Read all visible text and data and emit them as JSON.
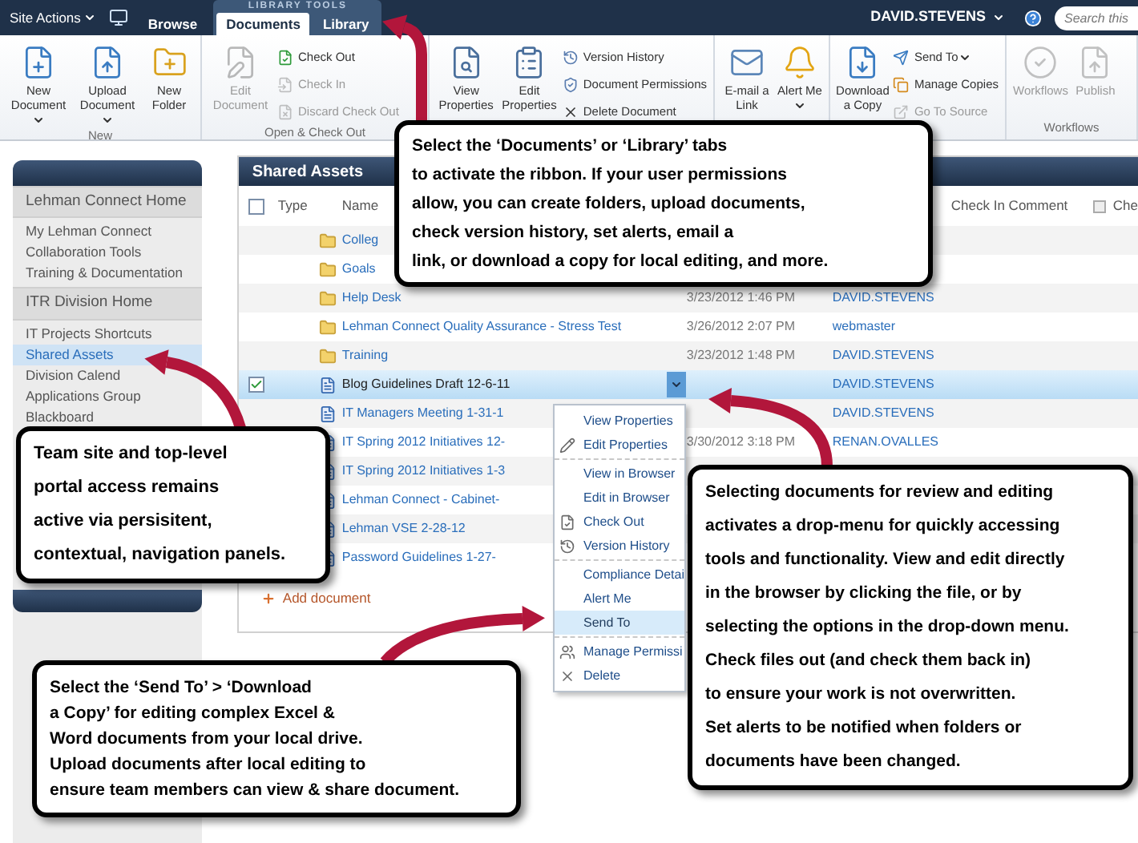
{
  "top_bar": {
    "site_actions": "Site Actions",
    "tabs": [
      {
        "label": "Browse",
        "selected": false
      }
    ],
    "tab_group": {
      "label": "LIBRARY TOOLS",
      "tabs": [
        {
          "label": "Documents",
          "selected": true
        },
        {
          "label": "Library",
          "selected": false
        }
      ]
    },
    "user": "DAVID.STEVENS",
    "search": {
      "placeholder": "Search this"
    }
  },
  "ribbon": {
    "groups": [
      {
        "label": "New",
        "buttons": [
          {
            "label": "New Document",
            "kind": "large",
            "dropdown": true,
            "disabled": false
          },
          {
            "label": "Upload Document",
            "kind": "large",
            "dropdown": true,
            "disabled": false
          },
          {
            "label": "New Folder",
            "kind": "large",
            "dropdown": false,
            "disabled": false
          }
        ]
      },
      {
        "label": "Open & Check Out",
        "buttons": [
          {
            "label": "Edit Document",
            "kind": "large",
            "dropdown": false,
            "disabled": true
          },
          {
            "label": "Check Out",
            "kind": "small",
            "dropdown": false,
            "disabled": false
          },
          {
            "label": "Check In",
            "kind": "small",
            "dropdown": false,
            "disabled": true
          },
          {
            "label": "Discard Check Out",
            "kind": "small",
            "dropdown": false,
            "disabled": true
          }
        ]
      },
      {
        "buttons": [
          {
            "label": "View Properties",
            "kind": "large",
            "dropdown": false,
            "disabled": false
          },
          {
            "label": "Edit Properties",
            "kind": "large",
            "dropdown": false,
            "disabled": false
          },
          {
            "label": "Version History",
            "kind": "small",
            "dropdown": false,
            "disabled": false
          },
          {
            "label": "Document Permissions",
            "kind": "small",
            "dropdown": false,
            "disabled": false
          },
          {
            "label": "Delete Document",
            "kind": "small",
            "dropdown": false,
            "disabled": false
          }
        ]
      },
      {
        "buttons": [
          {
            "label": "E-mail a Link",
            "kind": "large",
            "dropdown": false,
            "disabled": false
          },
          {
            "label": "Alert Me",
            "kind": "large",
            "dropdown": true,
            "disabled": false
          }
        ]
      },
      {
        "buttons": [
          {
            "label": "Download a Copy",
            "kind": "large",
            "dropdown": false,
            "disabled": false
          },
          {
            "label": "Send To",
            "kind": "small",
            "dropdown": true,
            "disabled": false
          },
          {
            "label": "Manage Copies",
            "kind": "small",
            "dropdown": false,
            "disabled": false
          },
          {
            "label": "Go To Source",
            "kind": "small",
            "dropdown": false,
            "disabled": true
          }
        ]
      },
      {
        "label": "Workflows",
        "buttons": [
          {
            "label": "Workflows",
            "kind": "large",
            "dropdown": false,
            "disabled": true
          },
          {
            "label": "Publish",
            "kind": "large",
            "dropdown": false,
            "disabled": true
          }
        ]
      }
    ]
  },
  "sidebar": {
    "sections": [
      {
        "title": "Lehman Connect Home",
        "items": [
          {
            "label": "My Lehman Connect",
            "selected": false
          },
          {
            "label": "Collaboration Tools",
            "selected": false
          },
          {
            "label": "Training & Documentation",
            "selected": false
          }
        ]
      },
      {
        "title": "ITR Division Home",
        "items": [
          {
            "label": "IT Projects Shortcuts",
            "selected": false
          },
          {
            "label": "Shared Assets",
            "selected": true
          },
          {
            "label": "Division Calend",
            "selected": false
          },
          {
            "label": "Applications Group",
            "selected": false
          },
          {
            "label": "Blackboard",
            "selected": false
          }
        ]
      }
    ]
  },
  "list": {
    "title": "Shared Assets",
    "select_all": {
      "checked": false
    },
    "columns": [
      {
        "label": "Type"
      },
      {
        "label": "Name"
      },
      {
        "label": "Check In Comment"
      },
      {
        "label": "Che"
      }
    ],
    "rows": [
      {
        "kind": "folder",
        "name": "Colleg",
        "selected": false,
        "checked": false
      },
      {
        "kind": "folder",
        "name": "Goals",
        "selected": false,
        "checked": false
      },
      {
        "kind": "folder",
        "name": "Help Desk",
        "modified": "3/23/2012 1:46 PM",
        "modified_by": "DAVID.STEVENS",
        "selected": false,
        "checked": false
      },
      {
        "kind": "folder",
        "name": "Lehman Connect Quality Assurance - Stress Test",
        "modified": "3/26/2012 2:07 PM",
        "modified_by": "webmaster",
        "selected": false,
        "checked": false
      },
      {
        "kind": "folder",
        "name": "Training",
        "modified": "3/23/2012 1:48 PM",
        "modified_by": "DAVID.STEVENS",
        "selected": false,
        "checked": false
      },
      {
        "kind": "document",
        "name": "Blog Guidelines Draft 12-6-11",
        "modified_by": "DAVID.STEVENS",
        "selected": true,
        "checked": true
      },
      {
        "kind": "document",
        "name": "IT Managers Meeting 1-31-1",
        "modified_by": "DAVID.STEVENS",
        "selected": false,
        "checked": false
      },
      {
        "kind": "document",
        "name": "IT Spring 2012 Initiatives 12-",
        "modified": "3/30/2012 3:18 PM",
        "modified_by": "RENAN.OVALLES",
        "selected": false,
        "checked": false
      },
      {
        "kind": "document",
        "name": "IT Spring 2012 Initiatives 1-3",
        "selected": false,
        "checked": false
      },
      {
        "kind": "document",
        "name": "Lehman Connect - Cabinet-",
        "selected": false,
        "checked": false
      },
      {
        "kind": "document",
        "name": "Lehman VSE 2-28-12",
        "selected": false,
        "checked": false
      },
      {
        "kind": "document",
        "name": "Password Guidelines 1-27-",
        "selected": false,
        "checked": false
      }
    ],
    "add_link": "Add document"
  },
  "context_menu": {
    "sections": [
      {
        "items": [
          {
            "label": "View Properties",
            "selected": false
          },
          {
            "label": "Edit Properties",
            "selected": false
          }
        ]
      },
      {
        "items": [
          {
            "label": "View in Browser",
            "selected": false
          },
          {
            "label": "Edit in Browser",
            "selected": false
          },
          {
            "label": "Check Out",
            "selected": false
          },
          {
            "label": "Version History",
            "selected": false
          }
        ]
      },
      {
        "items": [
          {
            "label": "Compliance Detai",
            "selected": false
          },
          {
            "label": "Alert Me",
            "selected": false
          },
          {
            "label": "Send To",
            "selected": true
          }
        ]
      },
      {
        "items": [
          {
            "label": "Manage Permissi",
            "selected": false
          },
          {
            "label": "Delete",
            "selected": false
          }
        ]
      }
    ]
  },
  "callouts": [
    {
      "lines": [
        "Select the ‘Documents’ or ‘Library’ tabs",
        "to activate the ribbon.  If your user permissions",
        "allow, you can create folders, upload documents,",
        "check version history, set alerts, email a",
        "link, or download a copy for local editing, and more."
      ]
    },
    {
      "lines": [
        "Team site and top-level",
        "portal access remains",
        "active via persisitent,",
        "contextual, navigation panels."
      ]
    },
    {
      "lines": [
        "Select the ‘Send To’ > ‘Download",
        "a Copy’ for editing complex Excel &",
        "Word documents from your local drive.",
        "Upload documents after local editing to",
        "ensure team members can view & share document."
      ]
    },
    {
      "lines": [
        "Selecting documents for review and editing",
        "activates a drop-menu for quickly accessing",
        "tools and functionality.  View and edit directly",
        "in the browser by clicking the file, or by",
        "selecting the options in the drop-down menu.",
        "Check files out (and check them back in)",
        "to ensure your work is not overwritten.",
        "Set alerts to be notified when folders or",
        "documents have been changed."
      ]
    }
  ]
}
